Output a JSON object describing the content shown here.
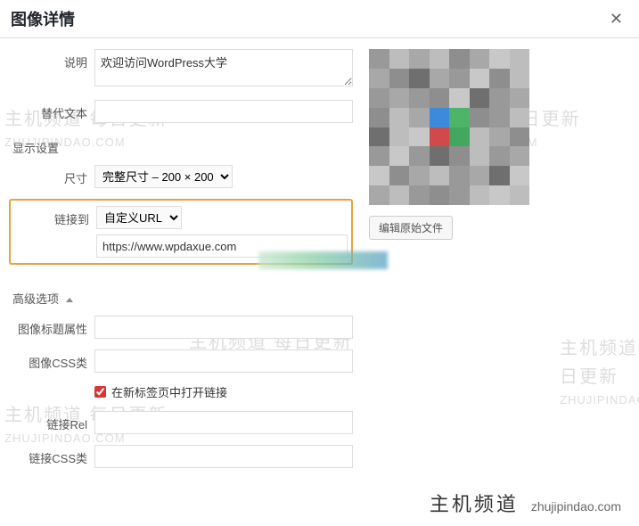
{
  "header": {
    "title": "图像详情"
  },
  "form": {
    "caption_label": "说明",
    "caption_value": "欢迎访问WordPress大学",
    "alt_label": "替代文本",
    "alt_value": "",
    "display_section": "显示设置",
    "size_label": "尺寸",
    "size_value": "完整尺寸 – 200 × 200",
    "linkto_label": "链接到",
    "linkto_value": "自定义URL",
    "url_value": "https://www.wpdaxue.com",
    "advanced_section": "高级选项",
    "title_attr_label": "图像标题属性",
    "title_attr_value": "",
    "css_class_label": "图像CSS类",
    "css_class_value": "",
    "newtab_label": "在新标签页中打开链接",
    "link_rel_label": "链接Rel",
    "link_rel_value": "",
    "link_css_label": "链接CSS类",
    "link_css_value": ""
  },
  "right": {
    "edit_original": "编辑原始文件"
  },
  "watermark": {
    "cn": "主机频道 每日更新",
    "en": "ZHUJIPINDAO.COM"
  },
  "footer": {
    "cn": "主机频道",
    "en": "zhujipindao.com"
  }
}
